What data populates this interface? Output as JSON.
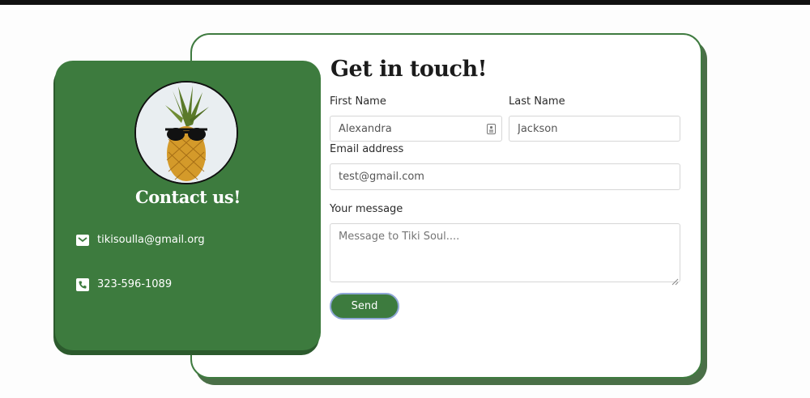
{
  "contact": {
    "title": "Contact us!",
    "email": "tikisoulla@gmail.org",
    "phone": "323-596-1089"
  },
  "form": {
    "title": "Get in touch!",
    "first_name_label": "First Name",
    "first_name_value": "Alexandra",
    "last_name_label": "Last Name",
    "last_name_value": "Jackson",
    "email_label": "Email address",
    "email_value": "test@gmail.com",
    "message_label": "Your message",
    "message_placeholder": "Message to Tiki Soul....",
    "send_label": "Send"
  },
  "colors": {
    "brand_green": "#3d7b3e",
    "shadow_green": "#2c5a2d"
  },
  "icons": [
    "envelope-icon",
    "phone-icon",
    "contact-card-icon",
    "resize-grip-icon"
  ]
}
